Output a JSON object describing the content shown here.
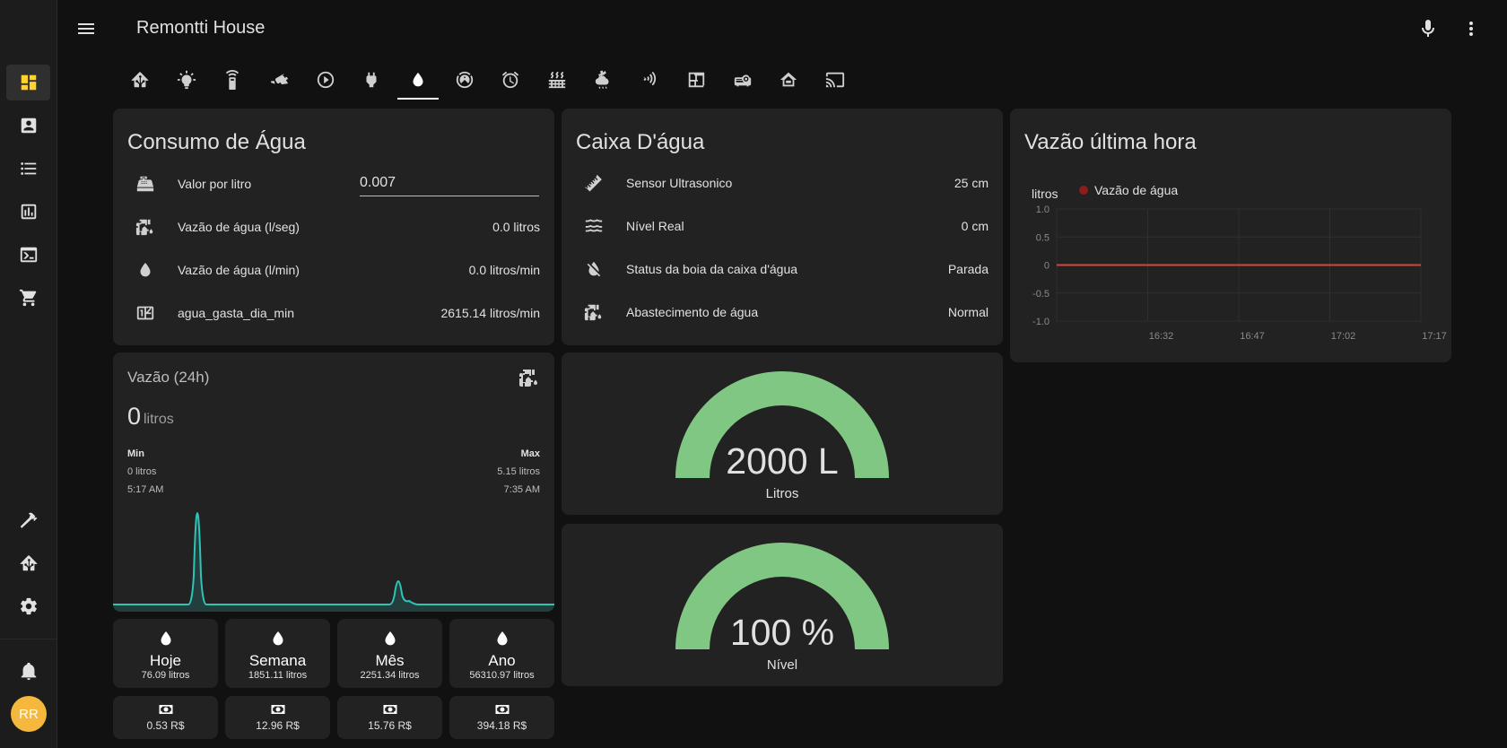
{
  "app": {
    "title": "Remontti House",
    "avatar_initials": "RR"
  },
  "sidebar": {
    "items": [
      {
        "icon": "view-dashboard-icon",
        "active": true
      },
      {
        "icon": "account-box-icon"
      },
      {
        "icon": "format-list-bulleted-icon"
      },
      {
        "icon": "chart-box-icon"
      },
      {
        "icon": "console-icon"
      },
      {
        "icon": "cart-icon"
      },
      {
        "icon": "hammer-icon"
      },
      {
        "icon": "home-assistant-icon"
      },
      {
        "icon": "cog-icon"
      },
      {
        "icon": "bell-icon"
      }
    ]
  },
  "tabs": [
    {
      "icon": "home-assistant-icon"
    },
    {
      "icon": "lightbulb-icon"
    },
    {
      "icon": "remote-icon"
    },
    {
      "icon": "cctv-icon"
    },
    {
      "icon": "play-circle-icon"
    },
    {
      "icon": "power-plug-icon"
    },
    {
      "icon": "water-icon",
      "active": true
    },
    {
      "icon": "robot-vacuum-icon"
    },
    {
      "icon": "alarm-icon"
    },
    {
      "icon": "radiator-icon"
    },
    {
      "icon": "weather-icon"
    },
    {
      "icon": "nfc-icon"
    },
    {
      "icon": "floor-plan-icon"
    },
    {
      "icon": "projector-icon"
    },
    {
      "icon": "home-roof-icon"
    },
    {
      "icon": "cast-icon"
    }
  ],
  "consumo": {
    "title": "Consumo de Água",
    "valor_label": "Valor por litro",
    "valor_value": "0.007",
    "rows": [
      {
        "name": "Vazão de água (l/seg)",
        "value": "0.0 litros",
        "icon": "water-pump-icon"
      },
      {
        "name": "Vazão de água (l/min)",
        "value": "0.0 litros/min",
        "icon": "water-icon"
      },
      {
        "name": "agua_gasta_dia_min",
        "value": "2615.14 litros/min",
        "icon": "counter-icon"
      }
    ]
  },
  "caixa": {
    "title": "Caixa D'água",
    "rows": [
      {
        "name": "Sensor Ultrasonico",
        "value": "25 cm",
        "icon": "ruler-icon"
      },
      {
        "name": "Nível Real",
        "value": "0 cm",
        "icon": "waves-icon"
      },
      {
        "name": "Status da boia da caixa d'água",
        "value": "Parada",
        "icon": "water-off-icon"
      },
      {
        "name": "Abastecimento de água",
        "value": "Normal",
        "icon": "water-pump-icon"
      }
    ]
  },
  "vazao_hora": {
    "title": "Vazão última hora",
    "ylabel": "litros",
    "legend": "Vazão de água",
    "series_color": "#db4437"
  },
  "vazao24": {
    "title": "Vazão (24h)",
    "value": "0",
    "unit": "litros",
    "min_label": "Min",
    "min_value": "0 litros",
    "min_time": "5:17 AM",
    "max_label": "Max",
    "max_value": "5.15 litros",
    "max_time": "7:35 AM",
    "line_color": "#2ec4b6"
  },
  "gauges": [
    {
      "value_text": "2000 L",
      "label": "Litros",
      "fraction": 1.0,
      "color": "#81c784"
    },
    {
      "value_text": "100 %",
      "label": "Nível",
      "fraction": 1.0,
      "color": "#81c784"
    }
  ],
  "totals": [
    {
      "name": "Hoje",
      "litros": "76.09 litros",
      "reais": "0.53 R$"
    },
    {
      "name": "Semana",
      "litros": "1851.11 litros",
      "reais": "12.96 R$"
    },
    {
      "name": "Mês",
      "litros": "2251.34 litros",
      "reais": "15.76 R$"
    },
    {
      "name": "Ano",
      "litros": "56310.97 litros",
      "reais": "394.18 R$"
    }
  ],
  "chart_data": {
    "type": "line",
    "title": "Vazão última hora",
    "ylabel": "litros",
    "xlabel": "",
    "x_ticks": [
      "16:32",
      "16:47",
      "17:02",
      "17:17"
    ],
    "y_ticks": [
      "1.0",
      "0.5",
      "0",
      "-0.5",
      "-1.0"
    ],
    "ylim": [
      -1.0,
      1.0
    ],
    "series": [
      {
        "name": "Vazão de água",
        "x": [
          "16:17",
          "17:17"
        ],
        "values": [
          0,
          0
        ]
      }
    ],
    "grid": true,
    "legend_position": "top"
  }
}
